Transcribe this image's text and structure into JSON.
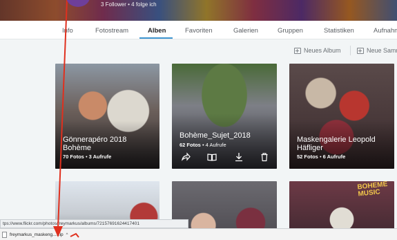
{
  "cover": {
    "stats": "3 Follower  •  4 folge ich"
  },
  "nav": {
    "tabs": [
      {
        "label": "Info"
      },
      {
        "label": "Fotostream"
      },
      {
        "label": "Alben"
      },
      {
        "label": "Favoriten"
      },
      {
        "label": "Galerien"
      },
      {
        "label": "Gruppen"
      },
      {
        "label": "Statistiken"
      },
      {
        "label": "Aufnahmen"
      }
    ],
    "active": "Alben"
  },
  "toolbar": {
    "new_album": "Neues Album",
    "new_set": "Neue Samm"
  },
  "albums": [
    {
      "title": "Gönnerapéro 2018 Bohème",
      "photos": "70 Fotos",
      "views": "3 Aufrufe"
    },
    {
      "title": "Bohème_Sujet_2018",
      "photos": "62 Fotos",
      "views": "4 Aufrufe"
    },
    {
      "title": "Maskengalerie Leopold Häfliger",
      "photos": "52 Fotos",
      "views": "6 Aufrufe"
    },
    {
      "title": ""
    },
    {
      "title": ""
    },
    {
      "title": "",
      "sign": "BOHEME MUSIC"
    }
  ],
  "status_bar": {
    "url": "tps://www.flickr.com/photos/freymarkus/albums/72157691624417401"
  },
  "download": {
    "filename": "freymarkus_maskeng....zip",
    "caret": "^"
  },
  "colors": {
    "accent": "#3e95d0",
    "annotation": "#e0301e"
  }
}
